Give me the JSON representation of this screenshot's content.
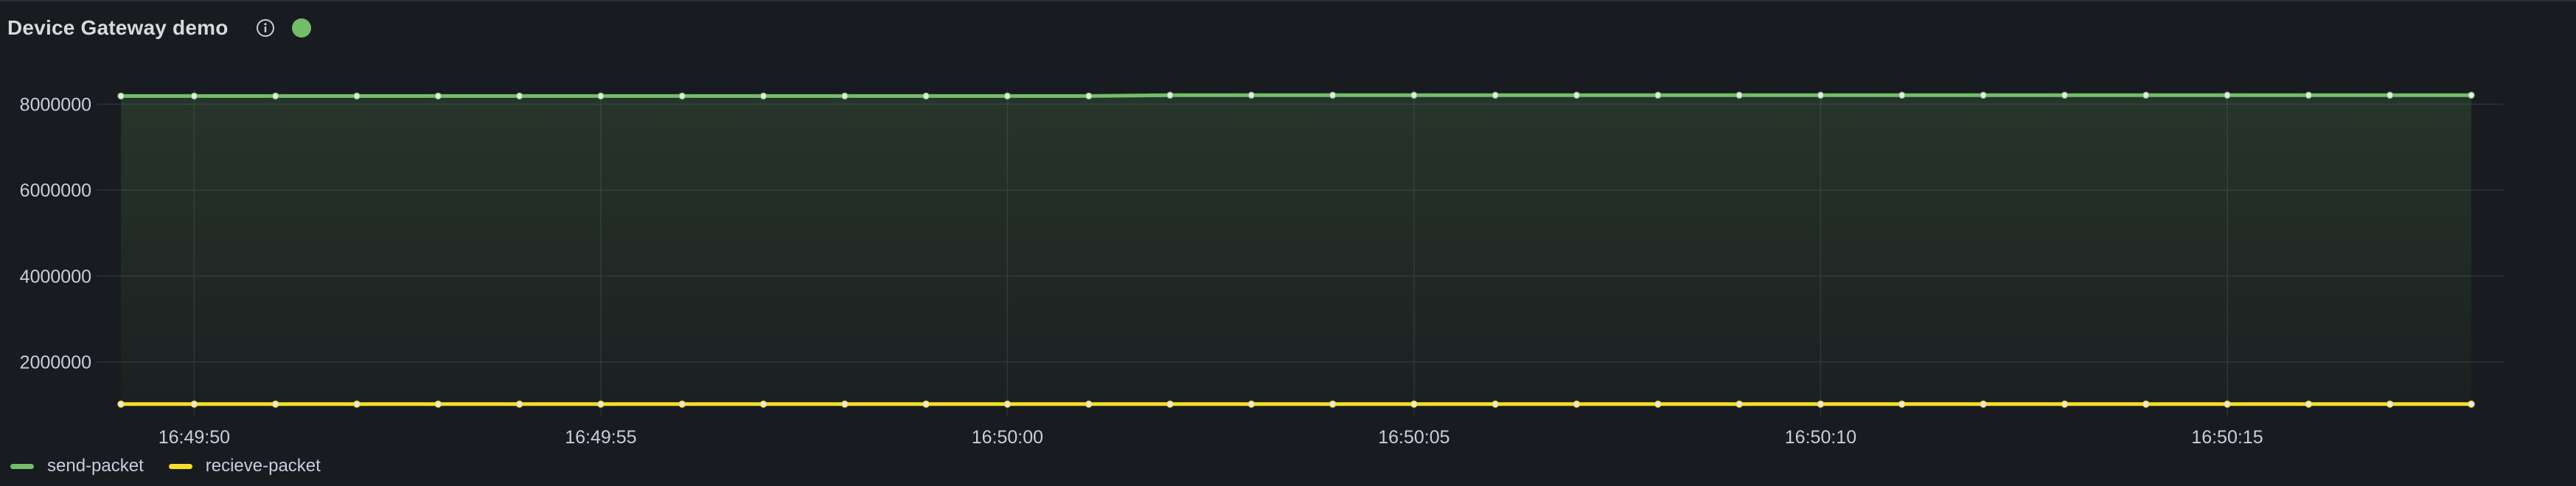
{
  "panel": {
    "title": "Device Gateway demo",
    "status_color": "#73bf69"
  },
  "colors": {
    "send": "#73bf69",
    "recieve": "#fade2a",
    "background": "#181b1f",
    "grid": "#2c3036",
    "tick_text": "#ccccdc"
  },
  "chart_data": {
    "type": "line",
    "title": "Device Gateway demo",
    "xlabel": "",
    "ylabel": "",
    "ylim": [
      1000000,
      8300000
    ],
    "yticks": [
      2000000,
      4000000,
      6000000,
      8000000
    ],
    "ytick_labels": [
      "2000000",
      "4000000",
      "6000000",
      "8000000"
    ],
    "xlim": [
      "16:49:48.8",
      "16:50:18.4"
    ],
    "xticks": [
      "16:49:50",
      "16:49:55",
      "16:50:00",
      "16:50:05",
      "16:50:10",
      "16:50:15"
    ],
    "grid": true,
    "legend": "bottom-left",
    "x": [
      "16:49:49.1",
      "16:49:50.0",
      "16:49:51.0",
      "16:49:52.0",
      "16:49:53.0",
      "16:49:54.0",
      "16:49:55.0",
      "16:49:56.0",
      "16:49:57.0",
      "16:49:58.0",
      "16:49:59.0",
      "16:50:00.0",
      "16:50:01.0",
      "16:50:02.0",
      "16:50:03.0",
      "16:50:04.0",
      "16:50:05.0",
      "16:50:06.0",
      "16:50:07.0",
      "16:50:08.0",
      "16:50:09.0",
      "16:50:10.0",
      "16:50:11.0",
      "16:50:12.0",
      "16:50:13.0",
      "16:50:14.0",
      "16:50:15.0",
      "16:50:16.0",
      "16:50:17.0",
      "16:50:18.0"
    ],
    "series": [
      {
        "name": "send-packet",
        "area_fill": true,
        "values": [
          8190000,
          8190000,
          8190000,
          8190000,
          8190000,
          8190000,
          8190000,
          8190000,
          8190000,
          8190000,
          8190000,
          8190000,
          8190000,
          8210000,
          8210000,
          8210000,
          8210000,
          8210000,
          8210000,
          8210000,
          8210000,
          8210000,
          8210000,
          8210000,
          8210000,
          8210000,
          8210000,
          8210000,
          8210000,
          8210000
        ]
      },
      {
        "name": "recieve-packet",
        "area_fill": false,
        "values": [
          1020000,
          1020000,
          1020000,
          1020000,
          1020000,
          1020000,
          1020000,
          1020000,
          1020000,
          1020000,
          1020000,
          1020000,
          1020000,
          1020000,
          1020000,
          1020000,
          1020000,
          1020000,
          1020000,
          1020000,
          1020000,
          1020000,
          1020000,
          1020000,
          1020000,
          1020000,
          1020000,
          1020000,
          1020000,
          1020000
        ]
      }
    ]
  },
  "legend": {
    "items": [
      {
        "label": "send-packet"
      },
      {
        "label": "recieve-packet"
      }
    ]
  }
}
